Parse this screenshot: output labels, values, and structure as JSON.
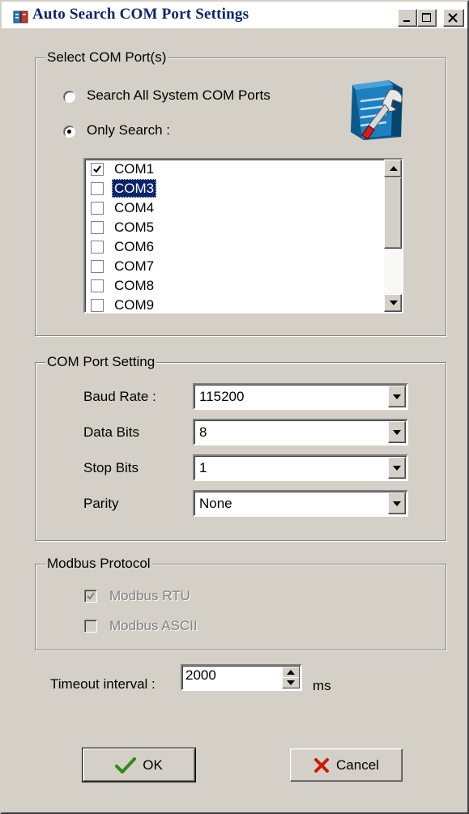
{
  "window": {
    "title": "Auto Search COM Port Settings",
    "controls": [
      "minimize",
      "maximize",
      "close"
    ]
  },
  "select_com": {
    "group_title": "Select COM Port(s)",
    "radio_all_label": "Search All System COM Ports",
    "radio_only_label": "Only Search :",
    "selected_radio": "only",
    "icon": "settings-wrench-icon",
    "ports": [
      {
        "label": "COM1",
        "checked": true,
        "selected": false
      },
      {
        "label": "COM3",
        "checked": false,
        "selected": true
      },
      {
        "label": "COM4",
        "checked": false,
        "selected": false
      },
      {
        "label": "COM5",
        "checked": false,
        "selected": false
      },
      {
        "label": "COM6",
        "checked": false,
        "selected": false
      },
      {
        "label": "COM7",
        "checked": false,
        "selected": false
      },
      {
        "label": "COM8",
        "checked": false,
        "selected": false
      },
      {
        "label": "COM9",
        "checked": false,
        "selected": false
      }
    ]
  },
  "port_setting": {
    "group_title": "COM Port Setting",
    "baud_label": "Baud Rate :",
    "baud_value": "115200",
    "data_bits_label": "Data Bits",
    "data_bits_value": "8",
    "stop_bits_label": "Stop Bits",
    "stop_bits_value": "1",
    "parity_label": "Parity",
    "parity_value": "None"
  },
  "modbus": {
    "group_title": "Modbus Protocol",
    "rtu_label": "Modbus RTU",
    "rtu_checked": true,
    "ascii_label": "Modbus ASCII",
    "ascii_checked": false,
    "enabled": false
  },
  "timeout": {
    "label": "Timeout interval :",
    "value": "2000",
    "unit": "ms"
  },
  "buttons": {
    "ok_label": "OK",
    "cancel_label": "Cancel"
  },
  "colors": {
    "face": "#d4d0c8",
    "title_text": "#0a246a",
    "selection": "#0a246a",
    "ok_check": "#2e8b10",
    "cancel_x": "#cc1a00"
  }
}
